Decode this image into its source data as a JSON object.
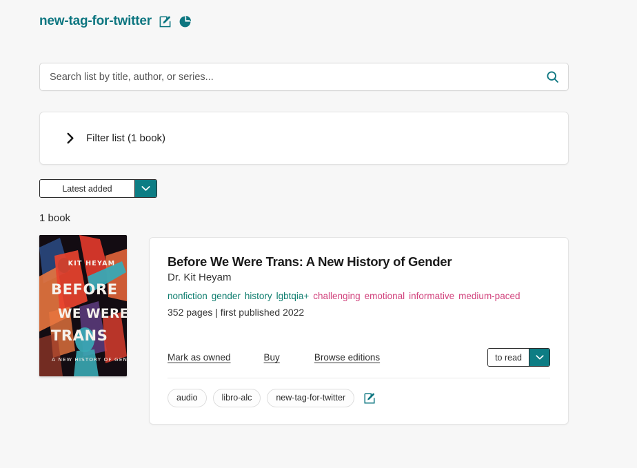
{
  "header": {
    "list_title": "new-tag-for-twitter",
    "edit_icon": "edit-square-pencil-icon",
    "stats_icon": "pie-chart-icon",
    "accent_color": "#0d7680"
  },
  "search": {
    "placeholder": "Search list by title, author, or series...",
    "value": "",
    "icon": "search-icon"
  },
  "filter": {
    "label": "Filter list (1 book)",
    "icon": "chevron-right-icon",
    "expanded": false
  },
  "sort": {
    "selected": "Latest added",
    "caret_icon": "chevron-down-icon",
    "caret_color": "#0d7d84"
  },
  "results": {
    "count_label": "1 book"
  },
  "book": {
    "title": "Before We Were Trans: A New History of Gender",
    "author": "Dr. Kit Heyam",
    "genre_tags": [
      "nonfiction",
      "gender",
      "history",
      "lgbtqia+"
    ],
    "mood_tags": [
      "challenging",
      "emotional",
      "informative",
      "medium-paced"
    ],
    "genre_color": "#0e7d6e",
    "mood_color": "#d1427c",
    "meta": "352 pages | first published 2022",
    "cover": {
      "alt": "book-cover-before-we-were-trans",
      "author_text": "KIT HEYAM",
      "title_line1": "BEFORE",
      "title_line2": "WE WERE",
      "title_line3": "TRANS",
      "subtitle": "A NEW HISTORY OF GENDER"
    },
    "actions": {
      "mark_as_owned": "Mark as owned",
      "buy": "Buy",
      "browse_editions": "Browse editions"
    },
    "shelf": {
      "selected": "to read",
      "caret_icon": "chevron-down-icon"
    },
    "tags": [
      "audio",
      "libro-alc",
      "new-tag-for-twitter"
    ],
    "tags_edit_icon": "edit-square-pencil-icon"
  }
}
